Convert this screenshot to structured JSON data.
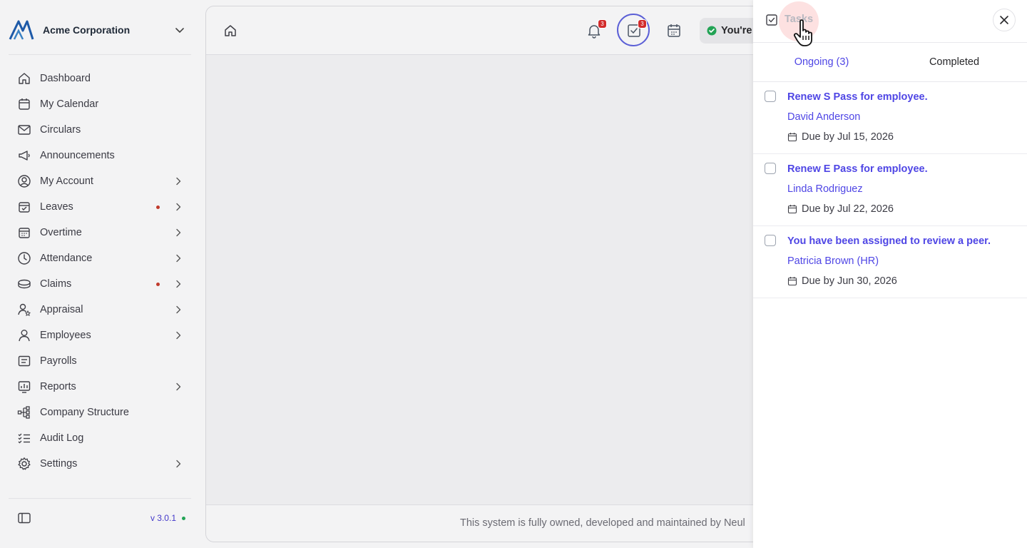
{
  "org": {
    "name": "Acme Corporation"
  },
  "sidebar": {
    "items": [
      {
        "label": "Dashboard",
        "icon": "home-icon",
        "chevron": false,
        "dot": false
      },
      {
        "label": "My Calendar",
        "icon": "calendar-icon",
        "chevron": false,
        "dot": false
      },
      {
        "label": "Circulars",
        "icon": "mail-icon",
        "chevron": false,
        "dot": false
      },
      {
        "label": "Announcements",
        "icon": "megaphone-icon",
        "chevron": false,
        "dot": false
      },
      {
        "label": "My Account",
        "icon": "user-circle-icon",
        "chevron": true,
        "dot": false
      },
      {
        "label": "Leaves",
        "icon": "calendar-check-icon",
        "chevron": true,
        "dot": true
      },
      {
        "label": "Overtime",
        "icon": "calendar-grid-icon",
        "chevron": true,
        "dot": false
      },
      {
        "label": "Attendance",
        "icon": "clock-icon",
        "chevron": true,
        "dot": false
      },
      {
        "label": "Claims",
        "icon": "coins-icon",
        "chevron": true,
        "dot": true
      },
      {
        "label": "Appraisal",
        "icon": "user-star-icon",
        "chevron": true,
        "dot": false
      },
      {
        "label": "Employees",
        "icon": "user-icon",
        "chevron": true,
        "dot": false
      },
      {
        "label": "Payrolls",
        "icon": "receipt-icon",
        "chevron": false,
        "dot": false
      },
      {
        "label": "Reports",
        "icon": "chart-icon",
        "chevron": true,
        "dot": false
      },
      {
        "label": "Company Structure",
        "icon": "org-chart-icon",
        "chevron": false,
        "dot": false
      },
      {
        "label": "Audit Log",
        "icon": "checklist-icon",
        "chevron": false,
        "dot": false
      },
      {
        "label": "Settings",
        "icon": "gear-icon",
        "chevron": true,
        "dot": false
      }
    ],
    "version": "v 3.0.1"
  },
  "topbar": {
    "notifications_count": "3",
    "tasks_count": "3",
    "status_text": "You're"
  },
  "footer": {
    "text": "This system is fully owned, developed and maintained by Neul"
  },
  "drawer": {
    "title": "Tasks",
    "tabs": [
      {
        "label": "Ongoing (3)",
        "active": true
      },
      {
        "label": "Completed",
        "active": false
      }
    ],
    "tasks": [
      {
        "title": "Renew S Pass for employee.",
        "person": "David Anderson",
        "due": "Due by Jul 15, 2026"
      },
      {
        "title": "Renew E Pass for employee.",
        "person": "Linda Rodriguez",
        "due": "Due by Jul 22, 2026"
      },
      {
        "title": "You have been assigned to review a peer.",
        "person": "Patricia Brown (HR)",
        "due": "Due by Jun 30, 2026"
      }
    ]
  },
  "colors": {
    "accent": "#4f46e5",
    "badge": "#d22b2b",
    "status_ok": "#22a355"
  }
}
